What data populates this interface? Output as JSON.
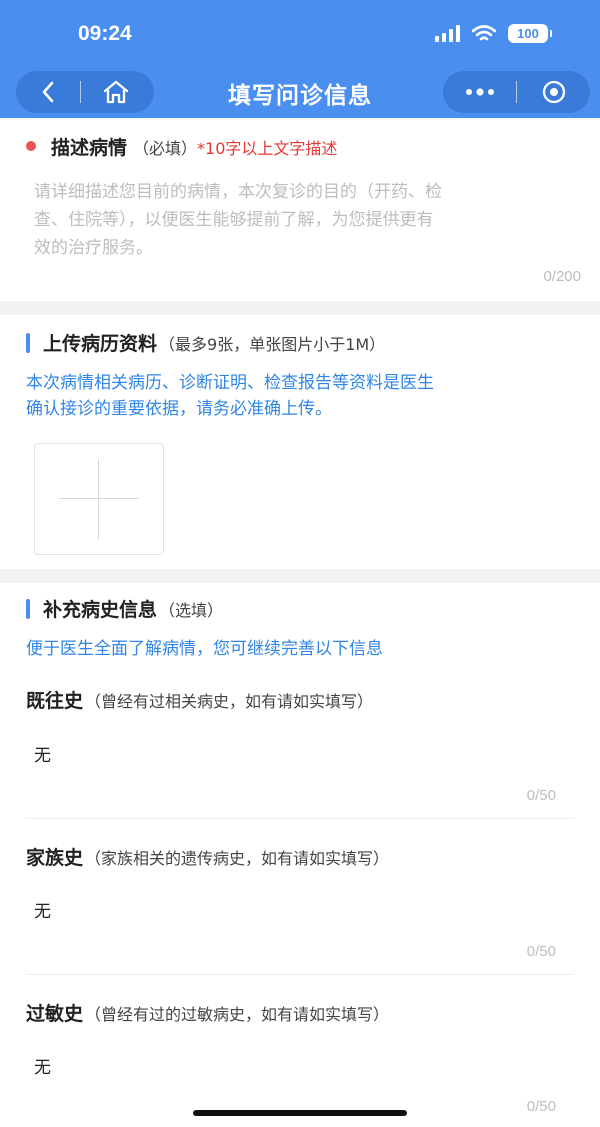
{
  "status_bar": {
    "time": "09:24",
    "battery": "100"
  },
  "nav": {
    "title": "填写问诊信息",
    "back_icon": "chevron-left-icon",
    "home_icon": "home-icon",
    "more_icon": "more-dots-icon",
    "close_icon": "target-circle-icon"
  },
  "describe": {
    "title": "描述病情",
    "required": "（必填）",
    "hint": "*10字以上文字描述",
    "placeholder_lines": [
      "请详细描述您目前的病情，本次复诊的目的（开药、检",
      "查、住院等），以便医生能够提前了解，为您提供更有",
      "效的治疗服务。"
    ],
    "counter": "0/200"
  },
  "upload": {
    "title": "上传病历资料",
    "note": "（最多9张，单张图片小于1M）",
    "info_lines": [
      "本次病情相关病历、诊断证明、检查报告等资料是医生",
      "确认接诊的重要依据，请务必准确上传。"
    ],
    "add_icon": "plus-icon"
  },
  "history": {
    "title": "补充病史信息",
    "optional": "（选填）",
    "info": "便于医生全面了解病情，您可继续完善以下信息",
    "items": [
      {
        "label": "既往史",
        "note": "（曾经有过相关病史，如有请如实填写）",
        "value": "无",
        "counter": "0/50"
      },
      {
        "label": "家族史",
        "note": "（家族相关的遗传病史，如有请如实填写）",
        "value": "无",
        "counter": "0/50"
      },
      {
        "label": "过敏史",
        "note": "（曾经有过的过敏病史，如有请如实填写）",
        "value": "无",
        "counter": "0/50"
      }
    ]
  },
  "colors": {
    "brand": "#4a8ef0",
    "required": "#e53935",
    "info": "#2f86e6"
  }
}
